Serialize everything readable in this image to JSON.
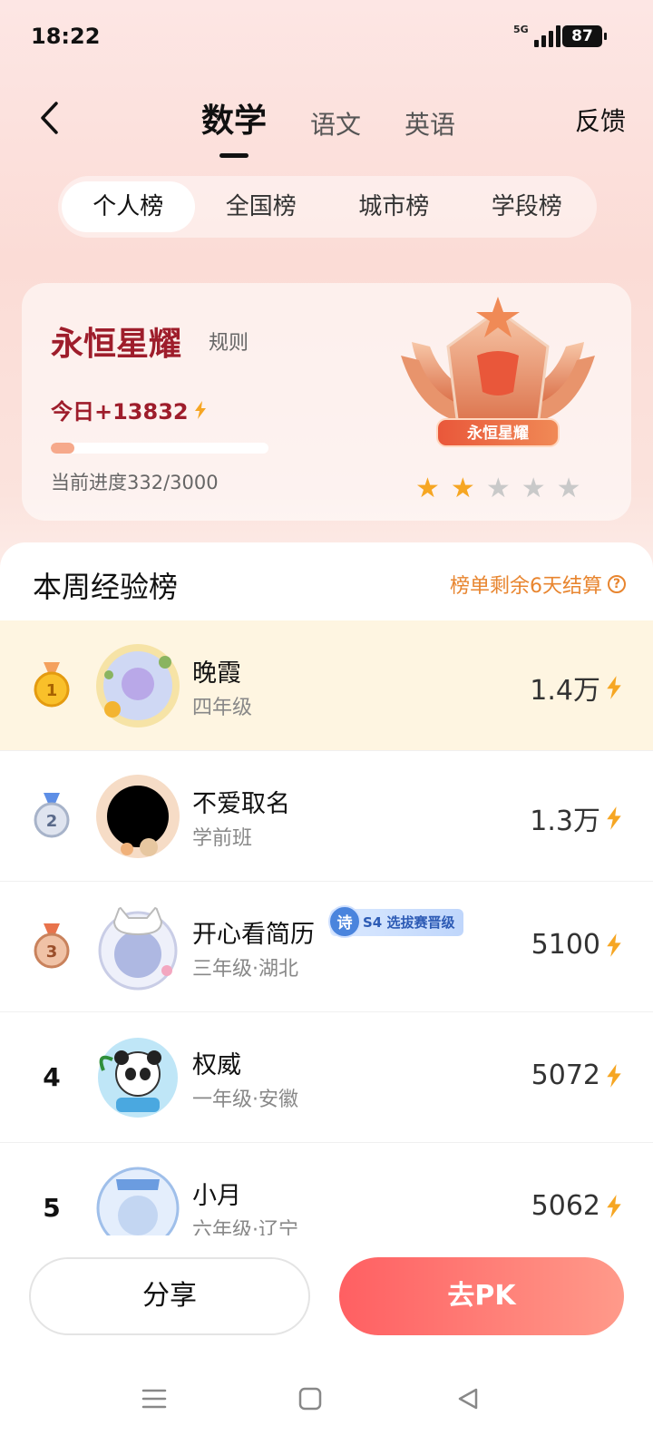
{
  "status_bar": {
    "time": "18:22",
    "network": "5G",
    "battery": "87"
  },
  "nav": {
    "subjects": [
      "数学",
      "语文",
      "英语"
    ],
    "feedback": "反馈"
  },
  "rank_tabs": [
    "个人榜",
    "全国榜",
    "城市榜",
    "学段榜"
  ],
  "level_card": {
    "level_name": "永恒星耀",
    "rule_label": "规则",
    "today_label": "今日+13832",
    "progress_text": "当前进度332/3000",
    "progress_fraction": 0.11,
    "badge_text": "永恒星耀",
    "stars_filled": 2,
    "stars_total": 5
  },
  "board": {
    "title": "本周经验榜",
    "remain_text": "榜单剩余6天结算",
    "rows": [
      {
        "rank": "1",
        "name": "晚霞",
        "grade": "四年级",
        "score": "1.4万"
      },
      {
        "rank": "2",
        "name": "不爱取名",
        "grade": "学前班",
        "score": "1.3万"
      },
      {
        "rank": "3",
        "name": "开心看简历",
        "grade": "三年级·湖北",
        "score": "5100",
        "tag_icon": "诗",
        "tag_text": "S4 选拔赛晋级"
      },
      {
        "rank": "4",
        "name": "权威",
        "grade": "一年级·安徽",
        "score": "5072"
      },
      {
        "rank": "5",
        "name": "小月",
        "grade": "六年级·辽宁",
        "score": "5062"
      }
    ]
  },
  "buttons": {
    "share": "分享",
    "pk": "去PK"
  },
  "colors": {
    "accent": "#ff6b6b",
    "level_red": "#9e1d2b",
    "orange": "#e8852f",
    "bolt": "#f6a623"
  },
  "icons": {
    "back": "chevron-left-icon",
    "bolt": "lightning-icon",
    "help": "question-circle-icon"
  }
}
